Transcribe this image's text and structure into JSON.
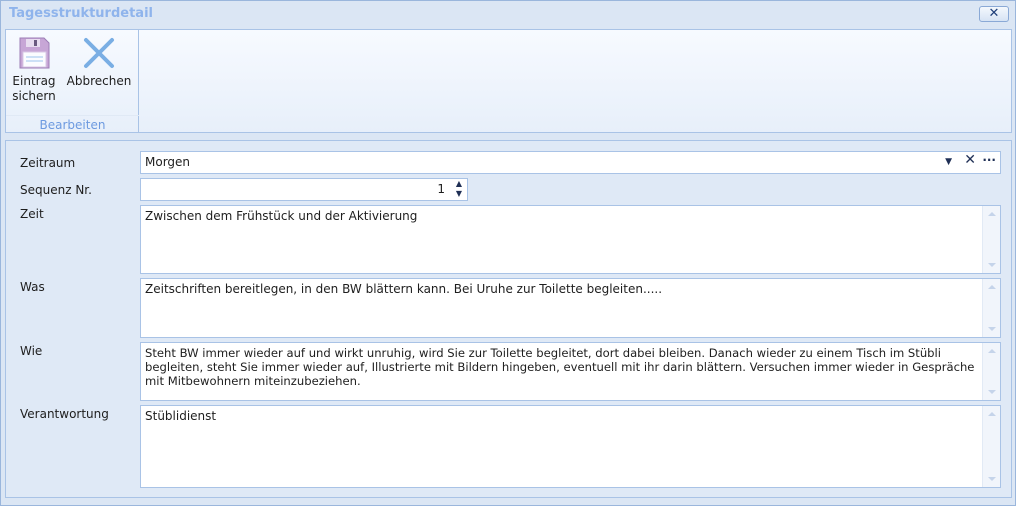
{
  "window": {
    "title": "Tagesstrukturdetail",
    "close_icon": "close-icon"
  },
  "ribbon": {
    "save_label_1": "Eintrag",
    "save_label_2": "sichern",
    "cancel_label": "Abbrechen",
    "group_label": "Bearbeiten"
  },
  "form": {
    "zeitraum": {
      "label": "Zeitraum",
      "value": "Morgen"
    },
    "sequenz": {
      "label": "Sequenz Nr.",
      "value": "1"
    },
    "zeit": {
      "label": "Zeit",
      "value": "Zwischen dem Frühstück und der Aktivierung"
    },
    "was": {
      "label": "Was",
      "value": "Zeitschriften bereitlegen, in den BW blättern kann. Bei Uruhe zur Toilette begleiten....."
    },
    "wie": {
      "label": "Wie",
      "value": "Steht BW immer wieder auf und wirkt unruhig, wird Sie zur Toilette begleitet, dort dabei bleiben. Danach wieder zu einem Tisch im Stübli begleiten, steht Sie immer wieder auf, Illustrierte mit Bildern hingeben, eventuell mit ihr darin blättern. Versuchen immer wieder in Gespräche mit Mitbewohnern miteinzubeziehen."
    },
    "verantwortung": {
      "label": "Verantwortung",
      "value": "Stüblidienst"
    }
  }
}
